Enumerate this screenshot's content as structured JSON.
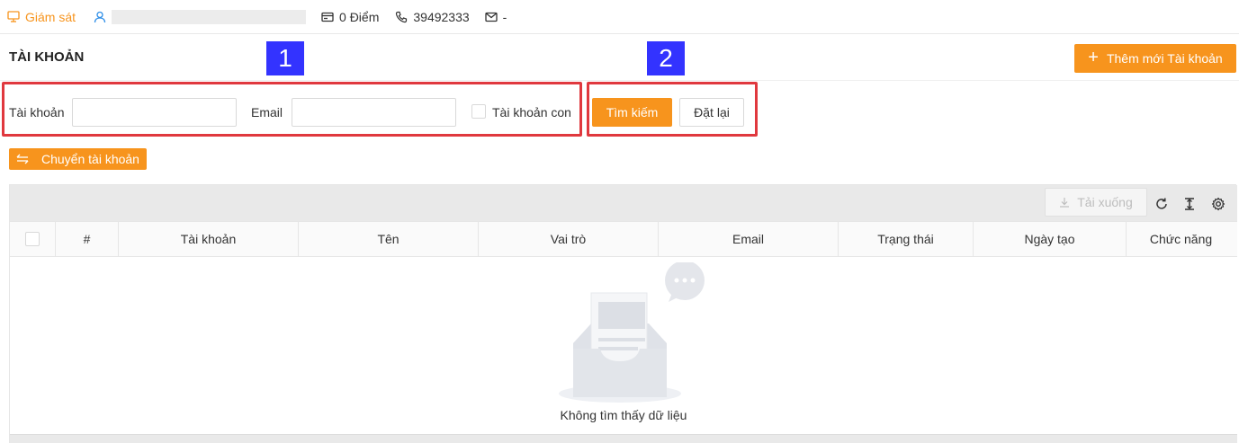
{
  "topbar": {
    "monitor_label": "Giám sát",
    "points_label": "0 Điểm",
    "phone_label": "39492333",
    "mail_label": "-"
  },
  "header": {
    "title": "TÀI KHOẢN",
    "add_button_label": "Thêm mới Tài khoản"
  },
  "callouts": [
    "1",
    "2"
  ],
  "search": {
    "account_label": "Tài khoản",
    "account_value": "",
    "email_label": "Email",
    "email_value": "",
    "sub_account_label": "Tài khoản con",
    "sub_account_checked": false,
    "search_button": "Tìm kiếm",
    "reset_button": "Đặt lại"
  },
  "switch_button": "Chuyển tài khoản",
  "table": {
    "download_label": "Tải xuống",
    "columns": [
      "",
      "#",
      "Tài khoản",
      "Tên",
      "Vai trò",
      "Email",
      "Trạng thái",
      "Ngày tạo",
      "Chức năng"
    ],
    "rows": [],
    "empty_text": "Không tìm thấy dữ liệu"
  },
  "colors": {
    "accent": "#f7941d",
    "callout": "#3333ff",
    "highlight": "#e0383e"
  }
}
